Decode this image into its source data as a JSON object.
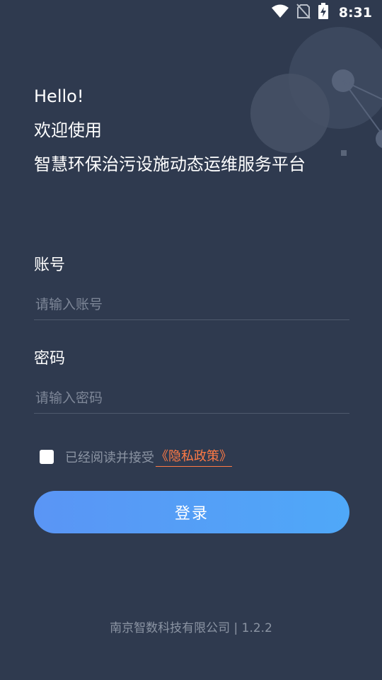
{
  "status_bar": {
    "time": "8:31",
    "icons": [
      "wifi-icon",
      "no-sim-icon",
      "battery-charging-icon"
    ]
  },
  "greeting": {
    "line1": "Hello!",
    "line2": "欢迎使用",
    "line3": "智慧环保治污设施动态运维服务平台"
  },
  "account": {
    "label": "账号",
    "placeholder": "请输入账号",
    "value": ""
  },
  "password": {
    "label": "密码",
    "placeholder": "请输入密码",
    "value": ""
  },
  "agreement": {
    "checked": false,
    "text": "已经阅读并接受",
    "link": "《隐私政策》"
  },
  "login": {
    "label": "登录"
  },
  "footer": {
    "text": "南京智数科技有限公司 | 1.2.2"
  },
  "colors": {
    "background": "#2f3a4f",
    "button_start": "#5a95f5",
    "button_end": "#4fa8f8",
    "link": "#ff7a45",
    "muted": "#8b94a3"
  }
}
